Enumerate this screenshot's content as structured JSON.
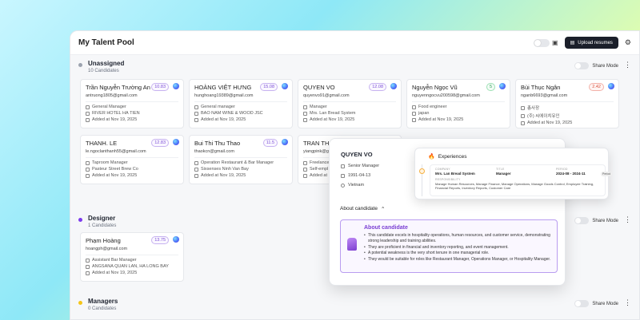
{
  "header": {
    "title": "My Talent Pool",
    "upload_label": "Upload resumes"
  },
  "sections": [
    {
      "title": "Unassigned",
      "count": "10 Candidates",
      "share": "Share Mode",
      "dot": "#9ca3af"
    },
    {
      "title": "Designer",
      "count": "1 Candidates",
      "share": "Share Mode",
      "dot": "#7c3aed"
    },
    {
      "title": "Managers",
      "count": "0 Candidates",
      "share": "Share Mode",
      "dot": "#f5c518"
    }
  ],
  "cards": [
    {
      "name": "Trần Nguyễn Trường An",
      "score": "10.83",
      "email": "antruong1805@gmail.com",
      "role": "General Manager",
      "company": "RIVER HOTEL HÀ TIÊN",
      "added": "Added at Nov 19, 2025"
    },
    {
      "name": "HOÀNG VIỆT HƯNG",
      "score": "15.08",
      "email": "hunghoang19389@gmail.com",
      "role": "General manager",
      "company": "BAO NAM WINE & WOOD JSC",
      "added": "Added at Nov 19, 2025"
    },
    {
      "name": "QUYEN VO",
      "score": "12.08",
      "email": "quyenvo91@gmail.com",
      "role": "Manager",
      "company": "Mrs. Lan Bread System",
      "added": "Added at Nov 19, 2025"
    },
    {
      "name": "Nguyễn Ngọc Vũ",
      "score": "5",
      "email": "nguyenngocvu200598@gmail.com",
      "role": "Food engineer",
      "company": "japan",
      "added": "Added at Nov 19, 2025"
    },
    {
      "name": "Bùi Thục Ngân",
      "score": "2.42",
      "email": "nganb6693@gmail.com",
      "role": "총사장",
      "company": "(주) 씨에이치유인",
      "added": "Added at Nov 19, 2025"
    },
    {
      "name": "THANH. LE",
      "score": "12.83",
      "email": "le.ngoclanthanh55@gmail.com",
      "role": "Taproom Manager",
      "company": "Pasteur Street Brew Co",
      "added": "Added at Nov 19, 2025"
    },
    {
      "name": "Bui Thi Thu Thao",
      "score": "11.5",
      "email": "thaokcn@gmail.com",
      "role": "Operation Restaurant & Bar Manager",
      "company": "Sixsenses Ninh Van Bay",
      "added": "Added at Nov 19, 2025"
    },
    {
      "name": "TRAN THỊ C",
      "score": "",
      "email": "yiangpink@g",
      "role": "Freelance",
      "company": "Self-empl",
      "added": "Added at"
    },
    {
      "name": "Phạm Hoàng",
      "score": "13.75",
      "email": "hoangph@gmail.com",
      "role": "Assistant Bar Manager",
      "company": "ANGSANA QUAN LAN, HA LONG BAY",
      "added": "Added at Nov 19, 2025"
    }
  ],
  "popover": {
    "name": "QUYEN VO",
    "role": "Senior Manager",
    "dob": "1991-04-13",
    "location": "Vietnam",
    "about_header": "About candidate",
    "about_title": "About candidate",
    "about_points": [
      "This candidate excels in hospitality operations, human resources, and customer service, demonstrating strong leadership and training abilities.",
      "They are proficient in financial and inventory reporting, and event management.",
      "A potential weakness is the very short tenure in one managerial role.",
      "They would be suitable for roles like Restaurant Manager, Operations Manager, or Hospitality Manager."
    ]
  },
  "experience": {
    "title": "Experiences",
    "company_label": "COMPANY",
    "company": "Mrs. Lan Bread System",
    "title_label": "TITLE",
    "job_title": "Manager",
    "period_label": "PERIOD",
    "period": "2024-08 - 2024-11",
    "period_badge": "Period",
    "resp_label": "RESPONSIBILITY",
    "responsibility": "Manage Human Resources, Manage Finance, Manage Operations, Manage Goods Control, Employee Training, Financial Reports, Inventory Reports, Customer Care"
  },
  "colors": {
    "accent": "#7c4fd6",
    "dark_button": "#1b1f2a"
  }
}
